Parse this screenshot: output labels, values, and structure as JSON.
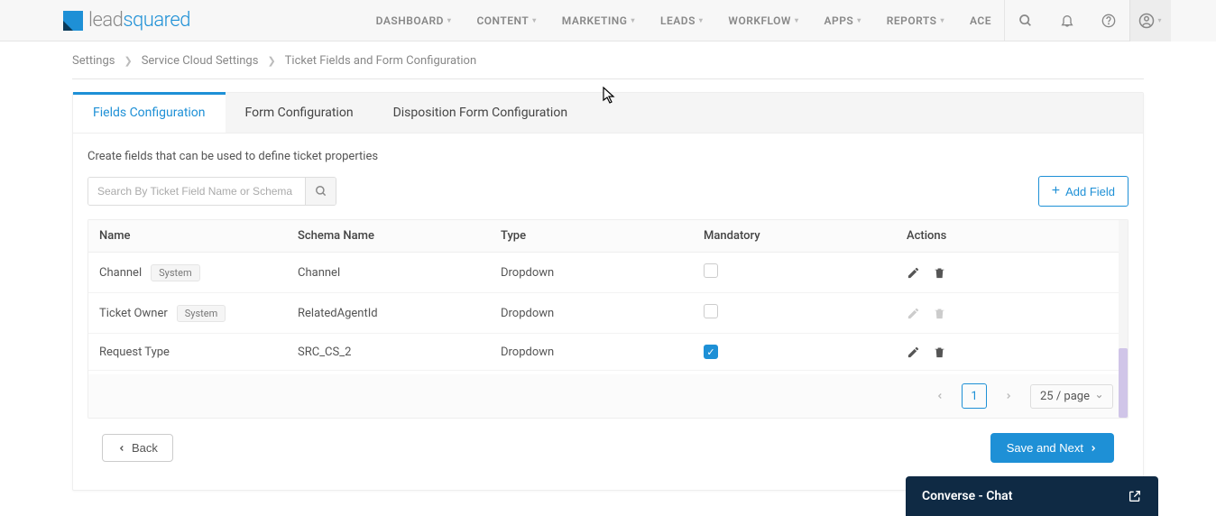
{
  "logo": {
    "lead": "lead",
    "squared": "squared"
  },
  "nav": {
    "items": [
      "DASHBOARD",
      "CONTENT",
      "MARKETING",
      "LEADS",
      "WORKFLOW",
      "APPS",
      "REPORTS",
      "ACE"
    ]
  },
  "breadcrumb": {
    "items": [
      "Settings",
      "Service Cloud Settings",
      "Ticket Fields and Form Configuration"
    ]
  },
  "tabs": [
    "Fields Configuration",
    "Form Configuration",
    "Disposition Form Configuration"
  ],
  "panel": {
    "description": "Create fields that can be used to define ticket properties",
    "search_placeholder": "Search By Ticket Field Name or Schema Name",
    "add_field": "Add Field"
  },
  "table": {
    "headers": [
      "Name",
      "Schema Name",
      "Type",
      "Mandatory",
      "Actions"
    ],
    "rows": [
      {
        "name": "Channel",
        "badge": "System",
        "schema": "Channel",
        "type": "Dropdown",
        "mandatory": false,
        "actions_enabled": true
      },
      {
        "name": "Ticket Owner",
        "badge": "System",
        "schema": "RelatedAgentId",
        "type": "Dropdown",
        "mandatory": false,
        "actions_enabled": false
      },
      {
        "name": "Request Type",
        "badge": null,
        "schema": "SRC_CS_2",
        "type": "Dropdown",
        "mandatory": true,
        "actions_enabled": true
      }
    ]
  },
  "footer": {
    "page": "1",
    "page_size": "25 / page"
  },
  "buttons": {
    "back": "Back",
    "save": "Save and Next"
  },
  "chat": {
    "title": "Converse - Chat"
  }
}
